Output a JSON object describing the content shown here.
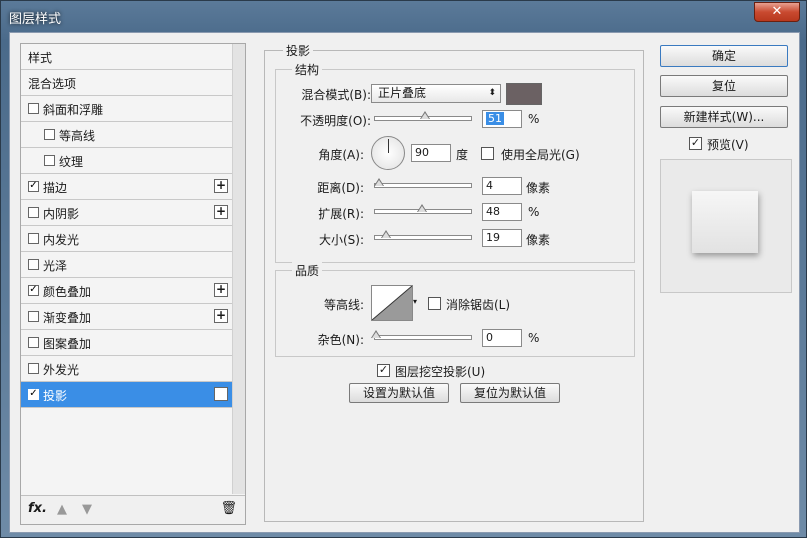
{
  "window": {
    "title": "图层样式",
    "close_label": "✕"
  },
  "styles_list": {
    "items": [
      {
        "label": "样式",
        "has_checkbox": false,
        "checked": false,
        "has_plus": false,
        "selected": false
      },
      {
        "label": "混合选项",
        "has_checkbox": false,
        "checked": false,
        "has_plus": false,
        "selected": false
      },
      {
        "label": "斜面和浮雕",
        "has_checkbox": true,
        "checked": false,
        "has_plus": false,
        "selected": false
      },
      {
        "label": "等高线",
        "has_checkbox": true,
        "checked": false,
        "has_plus": false,
        "selected": false,
        "indent": true
      },
      {
        "label": "纹理",
        "has_checkbox": true,
        "checked": false,
        "has_plus": false,
        "selected": false,
        "indent": true
      },
      {
        "label": "描边",
        "has_checkbox": true,
        "checked": true,
        "has_plus": true,
        "selected": false
      },
      {
        "label": "内阴影",
        "has_checkbox": true,
        "checked": false,
        "has_plus": true,
        "selected": false
      },
      {
        "label": "内发光",
        "has_checkbox": true,
        "checked": false,
        "has_plus": false,
        "selected": false
      },
      {
        "label": "光泽",
        "has_checkbox": true,
        "checked": false,
        "has_plus": false,
        "selected": false
      },
      {
        "label": "颜色叠加",
        "has_checkbox": true,
        "checked": true,
        "has_plus": true,
        "selected": false
      },
      {
        "label": "渐变叠加",
        "has_checkbox": true,
        "checked": false,
        "has_plus": true,
        "selected": false
      },
      {
        "label": "图案叠加",
        "has_checkbox": true,
        "checked": false,
        "has_plus": false,
        "selected": false
      },
      {
        "label": "外发光",
        "has_checkbox": true,
        "checked": false,
        "has_plus": false,
        "selected": false
      },
      {
        "label": "投影",
        "has_checkbox": true,
        "checked": true,
        "has_plus": true,
        "selected": true
      }
    ],
    "footer": {
      "fx_label": "fx.",
      "up_icon": "▲",
      "down_icon": "▼",
      "trash_icon": "🗑"
    }
  },
  "drop_shadow": {
    "section_title": "投影",
    "structure": {
      "title": "结构",
      "blend_mode_label": "混合模式(B):",
      "blend_mode_value": "正片叠底",
      "shadow_color": "#6b6163",
      "opacity_label": "不透明度(O):",
      "opacity_value": "51",
      "opacity_unit": "%",
      "angle_label": "角度(A):",
      "angle_value": "90",
      "angle_unit": "度",
      "global_light_label": "使用全局光(G)",
      "global_light_checked": false,
      "distance_label": "距离(D):",
      "distance_value": "4",
      "distance_unit": "像素",
      "spread_label": "扩展(R):",
      "spread_value": "48",
      "spread_unit": "%",
      "size_label": "大小(S):",
      "size_value": "19",
      "size_unit": "像素"
    },
    "quality": {
      "title": "品质",
      "contour_label": "等高线:",
      "anti_alias_label": "消除锯齿(L)",
      "anti_alias_checked": false,
      "noise_label": "杂色(N):",
      "noise_value": "0",
      "noise_unit": "%"
    },
    "knockout_label": "图层挖空投影(U)",
    "knockout_checked": true,
    "set_default_label": "设置为默认值",
    "reset_default_label": "复位为默认值"
  },
  "buttons": {
    "ok_label": "确定",
    "reset_label": "复位",
    "new_style_label": "新建样式(W)...",
    "preview_label": "预览(V)",
    "preview_checked": true
  }
}
